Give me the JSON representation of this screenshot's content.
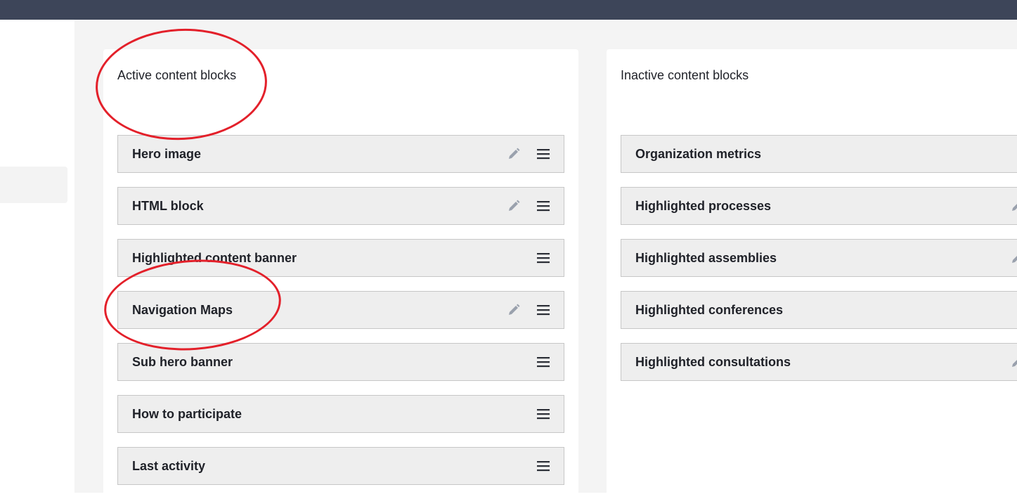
{
  "active_section": {
    "title": "Active content blocks",
    "blocks": [
      {
        "label": "Hero image",
        "editable": true
      },
      {
        "label": "HTML block",
        "editable": true
      },
      {
        "label": "Highlighted content banner",
        "editable": false
      },
      {
        "label": "Navigation Maps",
        "editable": true
      },
      {
        "label": "Sub hero banner",
        "editable": false
      },
      {
        "label": "How to participate",
        "editable": false
      },
      {
        "label": "Last activity",
        "editable": false
      }
    ]
  },
  "inactive_section": {
    "title": "Inactive content blocks",
    "blocks": [
      {
        "label": "Organization metrics"
      },
      {
        "label": "Highlighted processes"
      },
      {
        "label": "Highlighted assemblies"
      },
      {
        "label": "Highlighted conferences"
      },
      {
        "label": "Highlighted consultations"
      }
    ]
  },
  "colors": {
    "topbar": "#3d4559",
    "block_bg": "#eeeeee",
    "block_border": "#c7c7c7",
    "icon": "#9aa1ad",
    "annotation": "#e3202a"
  },
  "icons": {
    "edit": "pencil-icon",
    "drag": "drag-handle-icon"
  }
}
